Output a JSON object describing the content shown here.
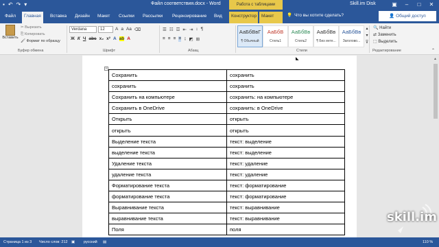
{
  "titlebar": {
    "document_title": "Файл соответствия.docx - Word",
    "tools_context": "Работа с таблицами",
    "account": "Skill.im Disk",
    "quick_access": [
      "save-icon",
      "undo-icon",
      "redo-icon"
    ],
    "window_controls": [
      "minimize-icon",
      "maximize-icon",
      "close-icon"
    ]
  },
  "tabs": [
    {
      "label": "Файл"
    },
    {
      "label": "Главная"
    },
    {
      "label": "Вставка"
    },
    {
      "label": "Дизайн"
    },
    {
      "label": "Макет"
    },
    {
      "label": "Ссылки"
    },
    {
      "label": "Рассылки"
    },
    {
      "label": "Рецензирование"
    },
    {
      "label": "Вид"
    },
    {
      "label": "Конструктор"
    },
    {
      "label": "Макет"
    }
  ],
  "tell_me": "Что вы хотите сделать?",
  "share": "Общий доступ",
  "ribbon": {
    "paste_label": "Вставить",
    "clipboard": {
      "cut": "Вырезать",
      "copy": "Копировать",
      "format_painter": "Формат по образцу",
      "group": "Буфер обмена"
    },
    "font": {
      "name": "Verdana",
      "size": "12",
      "group": "Шрифт",
      "bold": "Ж",
      "italic": "К",
      "underline": "Ч"
    },
    "paragraph": {
      "group": "Абзац",
      "pilcrow": "¶"
    },
    "styles": {
      "group": "Стили",
      "items": [
        {
          "preview": "АаБбВвГ",
          "name": "¶ Обычный"
        },
        {
          "preview": "АаБбВ",
          "name": "Стиль1"
        },
        {
          "preview": "АаБбВв",
          "name": "Стиль2"
        },
        {
          "preview": "АаБбВв",
          "name": "¶ Без инте..."
        },
        {
          "preview": "АаБбВв",
          "name": "Заголово..."
        }
      ]
    },
    "editing": {
      "find": "Найти",
      "replace": "Заменить",
      "select": "Выделить",
      "group": "Редактирование"
    }
  },
  "table": {
    "rows": [
      [
        "Сохранить",
        "сохранить"
      ],
      [
        "сохранить",
        "сохранить"
      ],
      [
        "Сохранить на компьютере",
        "сохранить: на компьютере"
      ],
      [
        "Сохранить в OneDrive",
        "сохранить: в OneDrive"
      ],
      [
        "Открыть",
        "открыть"
      ],
      [
        "открыть",
        "открыть"
      ],
      [
        "Выделение текста",
        "текст: выделение"
      ],
      [
        "выделение текста",
        "текст: выделение"
      ],
      [
        "Удаление текста",
        "текст: удаление"
      ],
      [
        "удаление текста",
        "текст: удаление"
      ],
      [
        "Форматирование текста",
        "текст: форматирование"
      ],
      [
        "форматирование текста",
        "текст: форматирование"
      ],
      [
        "Выравнивание текста",
        "текст: выравнивание"
      ],
      [
        "выравнивание текста",
        "текст: выравнивание"
      ],
      [
        "Поля",
        "поля"
      ]
    ]
  },
  "statusbar": {
    "page": "Страница 1 из 3",
    "words": "Число слов: 212",
    "language": "русский",
    "zoom": "110 %"
  },
  "watermark": "skill.im"
}
